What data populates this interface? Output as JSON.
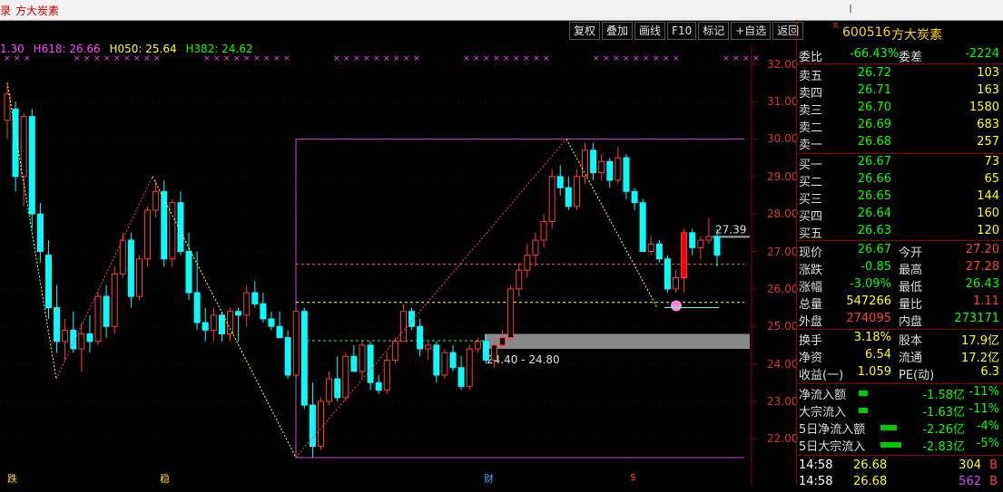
{
  "window": {
    "left_tab": "录",
    "title": "方大炭素",
    "pin_glyph": "𝄁"
  },
  "toolbar": [
    "复权",
    "叠加",
    "画线",
    "F10",
    "标记",
    "+自选",
    "返回"
  ],
  "indicator": {
    "first": "1.30",
    "h618": "H618: 26.66",
    "h050": "H050: 25.64",
    "h382": "H382: 24.62"
  },
  "stock": {
    "badge": "R",
    "code": "600516",
    "name": "方大炭素"
  },
  "price_axis": [
    "32.00",
    "31.00",
    "30.00",
    "29.00",
    "28.00",
    "27.00",
    "26.00",
    "25.00",
    "24.00",
    "23.00",
    "22.00"
  ],
  "last_price_tag": "27.39",
  "range_label": "24.40 - 24.80",
  "bottom_markers": {
    "m1": "跌",
    "m2": "稳",
    "m3": "财",
    "m4": "$"
  },
  "orderbook": {
    "weibi": {
      "label": "委比",
      "value": "-66.43%",
      "label2": "委差",
      "value2": "-2224"
    },
    "sell": [
      {
        "label": "卖五",
        "price": "26.72",
        "vol": "103"
      },
      {
        "label": "卖四",
        "price": "26.71",
        "vol": "163"
      },
      {
        "label": "卖三",
        "price": "26.70",
        "vol": "1580"
      },
      {
        "label": "卖二",
        "price": "26.69",
        "vol": "683"
      },
      {
        "label": "卖一",
        "price": "26.68",
        "vol": "257"
      }
    ],
    "buy": [
      {
        "label": "买一",
        "price": "26.67",
        "vol": "73"
      },
      {
        "label": "买二",
        "price": "26.66",
        "vol": "65"
      },
      {
        "label": "买三",
        "price": "26.65",
        "vol": "144"
      },
      {
        "label": "买四",
        "price": "26.64",
        "vol": "160"
      },
      {
        "label": "买五",
        "price": "26.63",
        "vol": "120"
      }
    ]
  },
  "quote": {
    "xianjia": {
      "label": "现价",
      "value": "26.67"
    },
    "jinkai": {
      "label": "今开",
      "value": "27.20"
    },
    "zhangdie": {
      "label": "涨跌",
      "value": "-0.85"
    },
    "zuigao": {
      "label": "最高",
      "value": "27.28"
    },
    "zhangfu": {
      "label": "涨幅",
      "value": "-3.09%"
    },
    "zuidi": {
      "label": "最低",
      "value": "26.43"
    },
    "zongliang": {
      "label": "总量",
      "value": "547266"
    },
    "liangbi": {
      "label": "量比",
      "value": "1.11"
    },
    "waipan": {
      "label": "外盘",
      "value": "274095"
    },
    "neipan": {
      "label": "内盘",
      "value": "273171"
    },
    "huanshou": {
      "label": "换手",
      "value": "3.18%"
    },
    "guben": {
      "label": "股本",
      "value": "17.9亿"
    },
    "jingzi": {
      "label": "净资",
      "value": "6.54"
    },
    "liutong": {
      "label": "流通",
      "value": "17.2亿"
    },
    "shouyi": {
      "label": "收益(一)",
      "value": "1.059"
    },
    "pe": {
      "label": "PE(动)",
      "value": "6.3"
    }
  },
  "flows": [
    {
      "label": "净流入额",
      "value": "-1.58亿",
      "pct": "-11%",
      "level": 0.4
    },
    {
      "label": "大宗流入",
      "value": "-1.63亿",
      "pct": "-11%",
      "level": 0.4
    },
    {
      "label": "5日净流入额",
      "value": "-2.26亿",
      "pct": "-4%",
      "level": 0.75
    },
    {
      "label": "5日大宗流入",
      "value": "-2.83亿",
      "pct": "-5%",
      "level": 0.95
    }
  ],
  "ticks": [
    {
      "time": "14:58",
      "price": "26.68",
      "vol": "304",
      "side": "B"
    },
    {
      "time": "14:58",
      "price": "26.68",
      "vol": "562",
      "side": "B"
    }
  ],
  "colors": {
    "up": "#ff3b3b",
    "down": "#00ffff",
    "box": "#cc44cc",
    "grid": "#8b0000"
  },
  "chart_data": {
    "type": "candlestick",
    "ylim": [
      21.5,
      32.5
    ],
    "candles": [
      [
        30.5,
        31.5,
        30.0,
        31.2
      ],
      [
        30.8,
        31.0,
        28.6,
        29.0
      ],
      [
        29.0,
        30.7,
        28.2,
        30.6
      ],
      [
        30.6,
        30.8,
        27.6,
        28.0
      ],
      [
        28.0,
        28.3,
        26.7,
        27.0
      ],
      [
        26.9,
        27.3,
        25.2,
        25.5
      ],
      [
        25.5,
        26.1,
        24.3,
        24.6
      ],
      [
        24.6,
        25.2,
        24.1,
        24.9
      ],
      [
        24.9,
        25.4,
        24.3,
        24.4
      ],
      [
        24.4,
        25.1,
        23.8,
        24.8
      ],
      [
        24.8,
        25.3,
        24.3,
        24.6
      ],
      [
        24.6,
        25.9,
        24.5,
        25.8
      ],
      [
        25.8,
        26.1,
        24.7,
        25.0
      ],
      [
        25.0,
        26.6,
        24.8,
        26.4
      ],
      [
        26.4,
        27.5,
        26.3,
        27.3
      ],
      [
        27.3,
        27.5,
        25.5,
        25.8
      ],
      [
        25.8,
        26.9,
        25.7,
        26.8
      ],
      [
        26.8,
        28.2,
        26.6,
        28.1
      ],
      [
        28.1,
        28.9,
        27.9,
        28.6
      ],
      [
        28.6,
        28.9,
        26.6,
        26.8
      ],
      [
        26.8,
        28.4,
        26.6,
        28.3
      ],
      [
        28.3,
        28.6,
        26.9,
        27.0
      ],
      [
        27.0,
        27.5,
        25.7,
        25.9
      ],
      [
        25.9,
        27.0,
        24.9,
        25.1
      ],
      [
        25.1,
        25.5,
        24.6,
        24.9
      ],
      [
        24.9,
        25.5,
        24.6,
        25.3
      ],
      [
        25.3,
        25.4,
        24.6,
        24.8
      ],
      [
        24.8,
        25.5,
        24.6,
        25.4
      ],
      [
        25.4,
        25.5,
        24.6,
        25.3
      ],
      [
        25.3,
        26.1,
        25.0,
        25.9
      ],
      [
        25.9,
        26.2,
        25.5,
        25.6
      ],
      [
        25.6,
        25.9,
        25.1,
        25.2
      ],
      [
        25.2,
        25.4,
        24.9,
        25.0
      ],
      [
        25.0,
        25.4,
        24.7,
        24.7
      ],
      [
        24.7,
        24.9,
        23.6,
        23.7
      ],
      [
        23.7,
        25.4,
        23.6,
        25.4
      ],
      [
        25.4,
        25.5,
        22.8,
        22.9
      ],
      [
        22.9,
        23.5,
        21.5,
        21.8
      ],
      [
        21.8,
        23.1,
        21.7,
        23.0
      ],
      [
        23.0,
        23.8,
        22.9,
        23.6
      ],
      [
        23.6,
        24.2,
        23.0,
        23.1
      ],
      [
        23.1,
        24.3,
        23.0,
        24.2
      ],
      [
        24.2,
        24.5,
        23.8,
        23.8
      ],
      [
        23.8,
        24.6,
        23.6,
        24.5
      ],
      [
        24.5,
        24.6,
        23.3,
        23.5
      ],
      [
        23.5,
        23.7,
        23.2,
        23.3
      ],
      [
        23.3,
        24.3,
        23.2,
        24.1
      ],
      [
        24.1,
        24.7,
        24.0,
        24.6
      ],
      [
        24.6,
        25.6,
        24.6,
        25.4
      ],
      [
        25.4,
        25.5,
        24.9,
        25.0
      ],
      [
        25.0,
        25.2,
        24.2,
        24.4
      ],
      [
        24.4,
        24.6,
        24.1,
        24.5
      ],
      [
        24.5,
        24.6,
        23.5,
        23.7
      ],
      [
        23.7,
        24.4,
        23.6,
        24.3
      ],
      [
        24.3,
        24.5,
        23.8,
        23.9
      ],
      [
        23.9,
        24.2,
        23.3,
        23.4
      ],
      [
        23.4,
        24.5,
        23.3,
        24.4
      ],
      [
        24.4,
        24.7,
        24.3,
        24.6
      ],
      [
        24.6,
        24.8,
        24.0,
        24.1
      ],
      [
        24.1,
        24.6,
        23.9,
        24.5
      ],
      [
        24.5,
        24.9,
        24.4,
        24.7
      ],
      [
        24.7,
        26.1,
        24.6,
        26.0
      ],
      [
        26.0,
        26.7,
        25.8,
        26.5
      ],
      [
        26.5,
        27.2,
        26.3,
        26.9
      ],
      [
        26.9,
        27.5,
        26.6,
        27.3
      ],
      [
        27.3,
        28.0,
        27.1,
        27.8
      ],
      [
        27.8,
        29.2,
        27.6,
        29.0
      ],
      [
        29.0,
        29.3,
        28.5,
        28.7
      ],
      [
        28.7,
        29.0,
        28.1,
        28.2
      ],
      [
        28.2,
        29.2,
        28.1,
        29.0
      ],
      [
        29.0,
        29.9,
        28.8,
        29.7
      ],
      [
        29.7,
        29.9,
        28.9,
        29.1
      ],
      [
        29.1,
        29.6,
        28.9,
        29.4
      ],
      [
        29.4,
        29.5,
        28.7,
        28.9
      ],
      [
        28.9,
        29.8,
        28.8,
        29.5
      ],
      [
        29.5,
        29.6,
        28.4,
        28.6
      ],
      [
        28.6,
        28.7,
        28.1,
        28.3
      ],
      [
        28.3,
        28.4,
        27.0,
        27.0
      ],
      [
        27.0,
        27.4,
        26.9,
        27.2
      ],
      [
        27.2,
        27.3,
        26.7,
        26.8
      ],
      [
        26.8,
        26.9,
        25.9,
        26.0
      ],
      [
        26.0,
        26.5,
        25.9,
        26.3
      ],
      [
        26.3,
        27.6,
        25.9,
        27.5
      ],
      [
        27.5,
        27.6,
        26.9,
        27.1
      ],
      [
        27.1,
        27.4,
        26.8,
        27.3
      ],
      [
        27.3,
        27.9,
        27.2,
        27.4
      ],
      [
        27.4,
        27.6,
        26.6,
        26.9
      ]
    ],
    "box": {
      "top": 30.0,
      "bottom": 21.5
    },
    "levels": [
      26.66,
      25.64,
      24.62,
      27.39
    ]
  }
}
